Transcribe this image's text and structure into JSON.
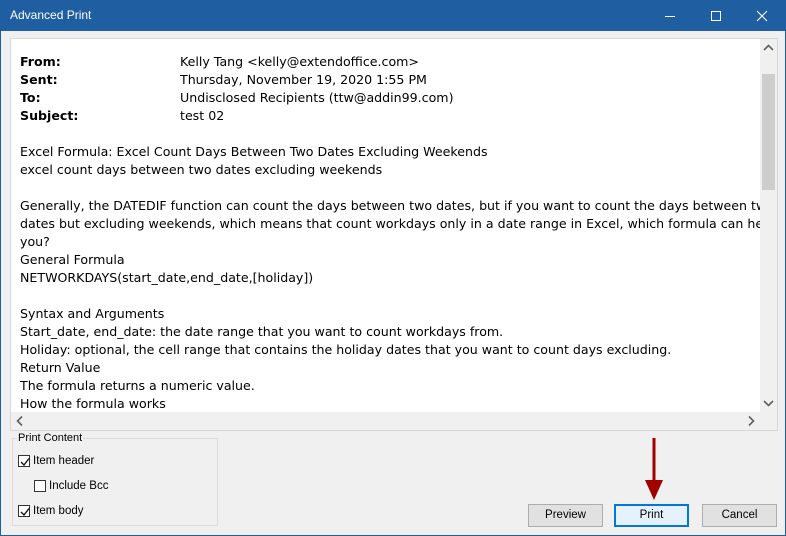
{
  "window": {
    "title": "Advanced Print"
  },
  "email": {
    "header": [
      {
        "label": "From:",
        "value": "Kelly Tang <kelly@extendoffice.com>"
      },
      {
        "label": "Sent:",
        "value": "Thursday, November 19, 2020 1:55 PM"
      },
      {
        "label": "To:",
        "value": "Undisclosed Recipients (ttw@addin99.com)"
      },
      {
        "label": "Subject:",
        "value": "test 02"
      }
    ],
    "body_lines": [
      "",
      "Excel Formula: Excel Count Days Between Two Dates Excluding Weekends",
      "excel count days between two dates excluding weekends",
      "",
      "Generally, the DATEDIF function can count the days between two dates, but if you want to count the days between two",
      "dates but excluding weekends, which means that count workdays only in a date range in Excel, which formula can help",
      "you?",
      "General Formula",
      "NETWORKDAYS(start_date,end_date,[holiday])",
      "",
      "Syntax and Arguments",
      "Start_date, end_date: the date range that you want to count workdays from.",
      "Holiday: optional, the cell range that contains the holiday dates that you want to count days excluding.",
      "Return Value",
      "The formula returns a numeric value.",
      "How the formula works"
    ]
  },
  "print_content": {
    "label": "Print Content",
    "item_header": {
      "label": "Item header",
      "checked": true
    },
    "include_bcc": {
      "label": "Include Bcc",
      "checked": false
    },
    "item_body": {
      "label": "Item body",
      "checked": true
    }
  },
  "buttons": {
    "preview": "Preview",
    "print": "Print",
    "cancel": "Cancel"
  },
  "colors": {
    "titlebar": "#1f5ea1",
    "accent": "#0078d7",
    "arrow": "#a00000"
  }
}
